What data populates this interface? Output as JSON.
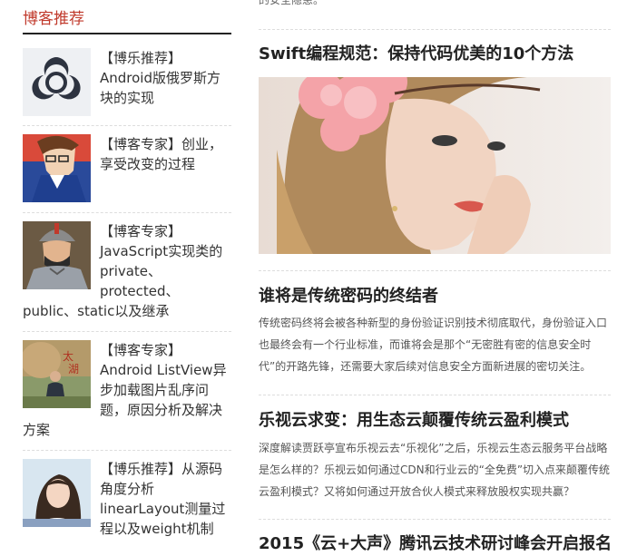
{
  "sidebar": {
    "heading": "博客推荐",
    "items": [
      {
        "text": "【博乐推荐】Android版俄罗斯方块的实现",
        "thumb_icon": "biohazard-icon"
      },
      {
        "text": "【博客专家】创业，享受改变的过程",
        "thumb_icon": "anime-avatar"
      },
      {
        "text": "【博客专家】JavaScript实现类的private、protected、public、static以及继承",
        "thumb_icon": "warrior-avatar"
      },
      {
        "text": "【博客专家】Android ListView异步加载图片乱序问题，原因分析及解决方案",
        "thumb_icon": "person-photo"
      },
      {
        "text": "【博乐推荐】从源码角度分析linearLayout测量过程以及weight机制",
        "thumb_icon": "girl-photo"
      }
    ]
  },
  "main": {
    "cut_off_text": "的安全隐患。",
    "articles": [
      {
        "title": "Swift编程规范：保持代码优美的10个方法",
        "image_icon": "woman-with-flower-photo"
      },
      {
        "title": "谁将是传统密码的终结者",
        "description": "传统密码终将会被各种新型的身份验证识别技术彻底取代，身份验证入口也最终会有一个行业标准，而谁将会是那个“无密胜有密的信息安全时代”的开路先锋，还需要大家后续对信息安全方面新进展的密切关注。"
      },
      {
        "title": "乐视云求变：用生态云颠覆传统云盈利模式",
        "description": "深度解读贾跃亭宣布乐视云去“乐视化”之后，乐视云生态云服务平台战略是怎么样的？乐视云如何通过CDN和行业云的“全免费”切入点来颠覆传统云盈利模式？又将如何通过开放合伙人模式来释放股权实现共赢？"
      },
      {
        "title": "2015《云+大声》腾讯云技术研讨峰会开启报名"
      }
    ]
  },
  "colors": {
    "heading_red": "#c0392b",
    "text": "#333333",
    "divider": "#dddddd"
  }
}
